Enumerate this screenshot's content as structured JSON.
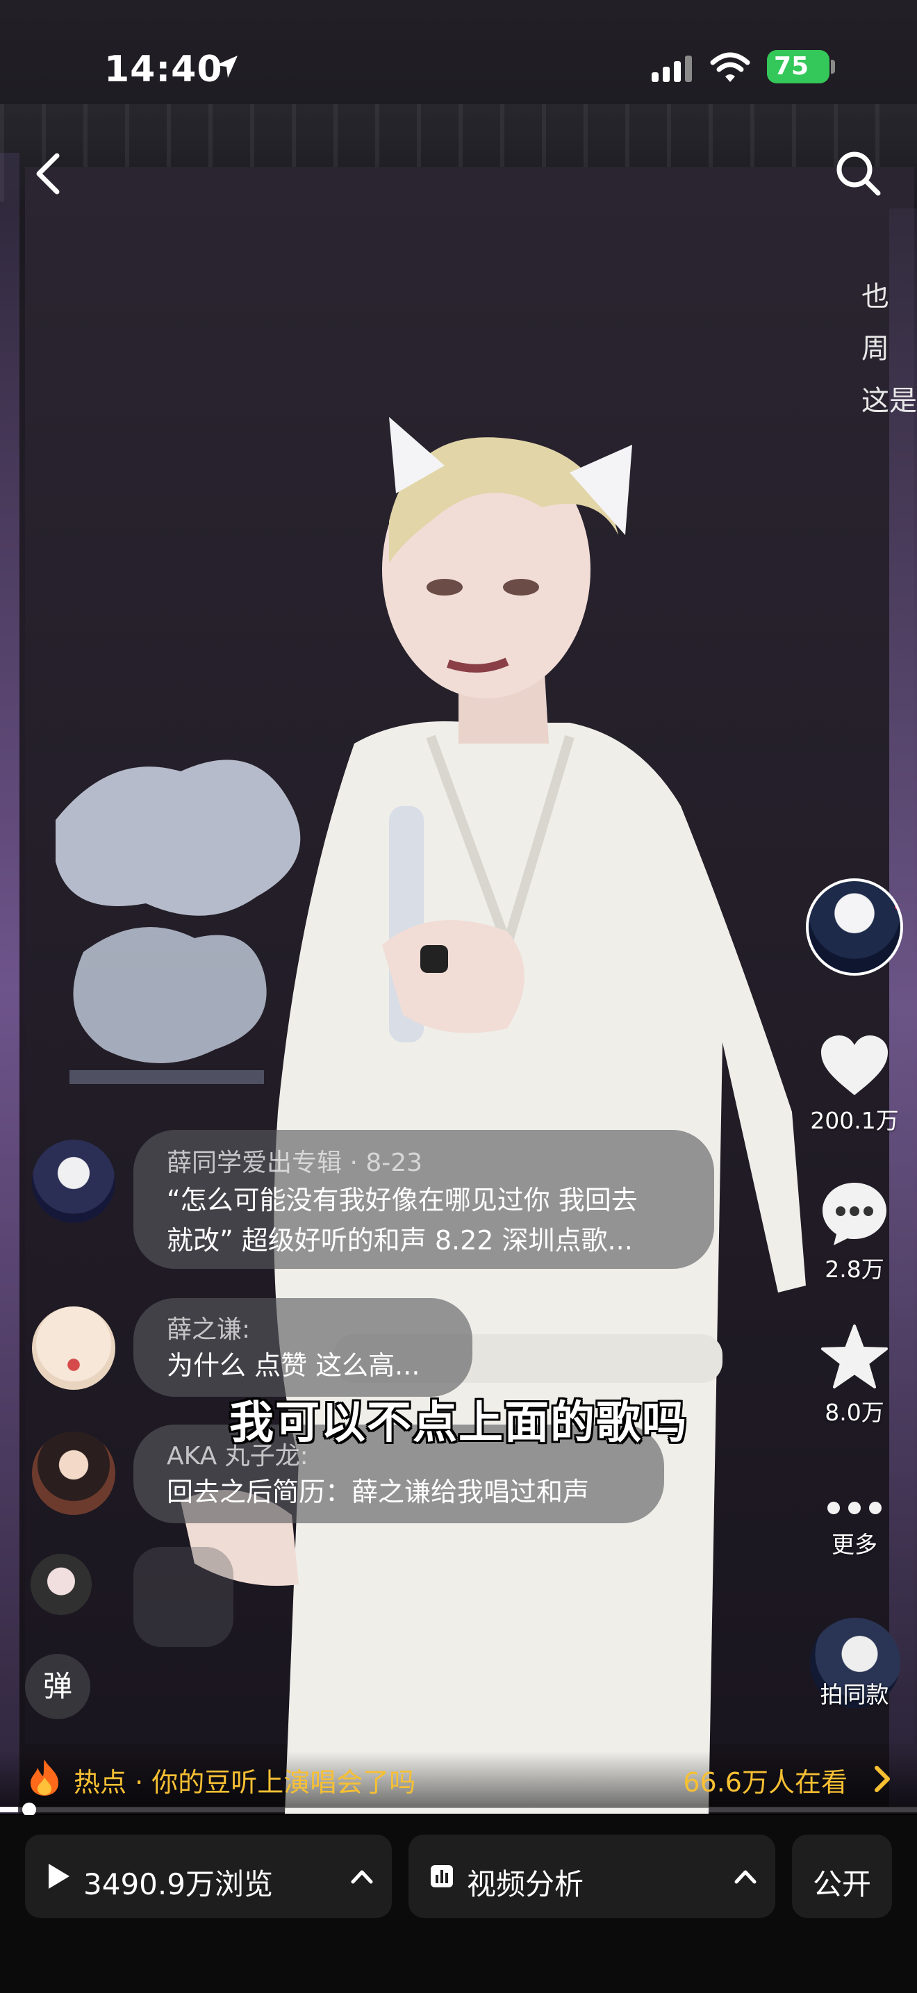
{
  "status_bar": {
    "time": "14:40",
    "battery": "75"
  },
  "video": {
    "subtitle": "我可以不点上面的歌吗",
    "side_text": [
      "也",
      "周",
      "这是"
    ]
  },
  "rail": {
    "likes": "200.1万",
    "comments": "2.8万",
    "favorites": "8.0万",
    "more": "更多",
    "same_style": "拍同款"
  },
  "comments": [
    {
      "name": "薛同学爱出专辑 · 8-23",
      "lines": [
        "“怎么可能没有我好像在哪见过你 我回去",
        "就改” 超级好听的和声 8.22 深圳点歌..."
      ]
    },
    {
      "name": "薛之谦:",
      "lines": [
        "为什么 点赞 这么高..."
      ]
    },
    {
      "name": "AKA 丸子龙:",
      "lines": [
        "回去之后简历：薛之谦给我唱过和声"
      ]
    }
  ],
  "danmu_label": "弹",
  "hot": {
    "text": "热点 · 你的豆听上演唱会了吗",
    "viewers": "66.6万人在看"
  },
  "progress": {
    "fraction": 0.02
  },
  "bottom": {
    "views": "3490.9万浏览",
    "analysis": "视频分析",
    "visibility": "公开"
  },
  "colors": {
    "accent": "#f7c033",
    "battery": "#34c759",
    "bubble": "#5a5a5f"
  }
}
